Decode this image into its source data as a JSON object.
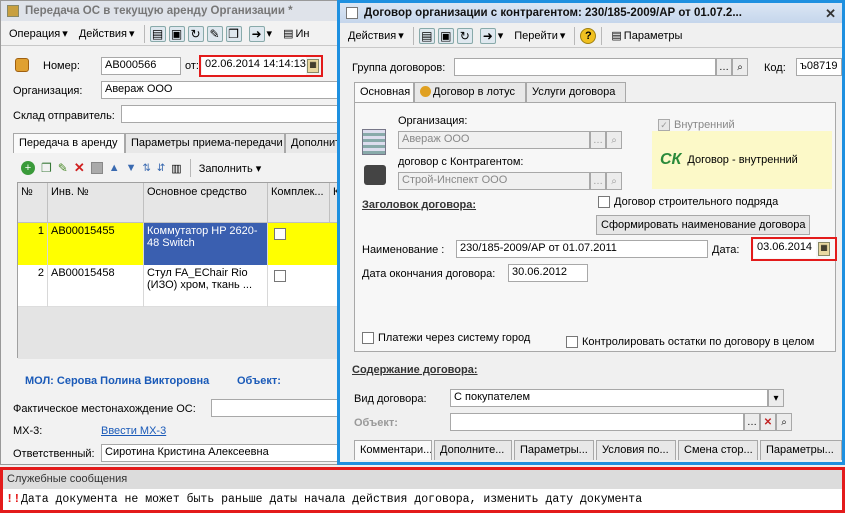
{
  "left_window": {
    "title": "Передача ОС в текущую аренду Организации *",
    "toolbar": {
      "operation": "Операция",
      "actions": "Действия",
      "more": "Ин"
    },
    "number_label": "Номер:",
    "number_value": "АВ000566",
    "date_label": "от:",
    "date_value": "02.06.2014 14:14:13",
    "org_label": "Организация:",
    "org_value": "Авераж ООО",
    "warehouse_label": "Склад отправитель:",
    "tabs": [
      "Передача в аренду",
      "Параметры приема-передачи",
      "Дополнит"
    ],
    "grid_toolbar": {
      "fill": "Заполнить"
    },
    "columns": [
      "№",
      "Инв. №",
      "Основное средство",
      "Комплек...",
      "К"
    ],
    "rows": [
      {
        "num": "1",
        "inv": "АВ00015455",
        "asset": "Коммутатор HP 2620-48 Switch"
      },
      {
        "num": "2",
        "inv": "АВ00015458",
        "asset": "Стул FA_EChair Rio (ИЗО) хром, ткань ..."
      }
    ],
    "mol_text": "МОЛ: Серова Полина Викторовна",
    "object_text": "Объект:",
    "location_label": "Фактическое местонахождение ОС:",
    "mx3_label": "МХ-3:",
    "mx3_link": "Ввести МХ-3",
    "responsible_label": "Ответственный:",
    "responsible_value": "Сиротина Кристина Алексеевна"
  },
  "right_window": {
    "title": "Договор организации с контрагентом: 230/185-2009/АР от 01.07.2...",
    "toolbar": {
      "actions": "Действия",
      "go": "Перейти",
      "params": "Параметры"
    },
    "group_label": "Группа договоров:",
    "group_value": "",
    "code_label": "Код:",
    "code_value": "ъ08719",
    "tabs": [
      "Основная",
      "Договор в лотус",
      "Услуги договора"
    ],
    "org_label": "Организация:",
    "org_value": "Авераж ООО",
    "internal_label": "Внутренний",
    "contractor_label": "договор с Контрагентом:",
    "contractor_value": "Строй-Инспект ООО",
    "badge_logo": "СК",
    "badge_text": "Договор - внутренний",
    "construction_label": "Договор строительного подряда",
    "header_title": "Заголовок договора:",
    "form_name_button": "Сформировать наименование договора",
    "name_label": "Наименование :",
    "name_value": "230/185-2009/АР от 01.07.2011",
    "date_label": "Дата:",
    "date_value": "03.06.2014",
    "end_date_label": "Дата окончания договора:",
    "end_date_value": "30.06.2012",
    "payments_label": "Платежи через систему город",
    "control_label": "Контролировать остатки по договору в целом",
    "content_title": "Содержание договора:",
    "type_label": "Вид договора:",
    "type_value": "С покупателем",
    "object_label": "Объект:",
    "object_value": "",
    "bottom_tabs": [
      "Комментари...",
      "Дополните...",
      "Параметры...",
      "Условия по...",
      "Смена стор...",
      "Параметры..."
    ]
  },
  "messages": {
    "title": "Служебные сообщения",
    "text": "Дата документа не может быть раньше даты начала действия договора, изменить дату документа"
  },
  "colors": {
    "highlight_red": "#e31b1b",
    "highlight_blue": "#1e90e0",
    "selected_row": "#ffff00",
    "selected_cell": "#3a5fb0",
    "link": "#1a5ab8"
  }
}
